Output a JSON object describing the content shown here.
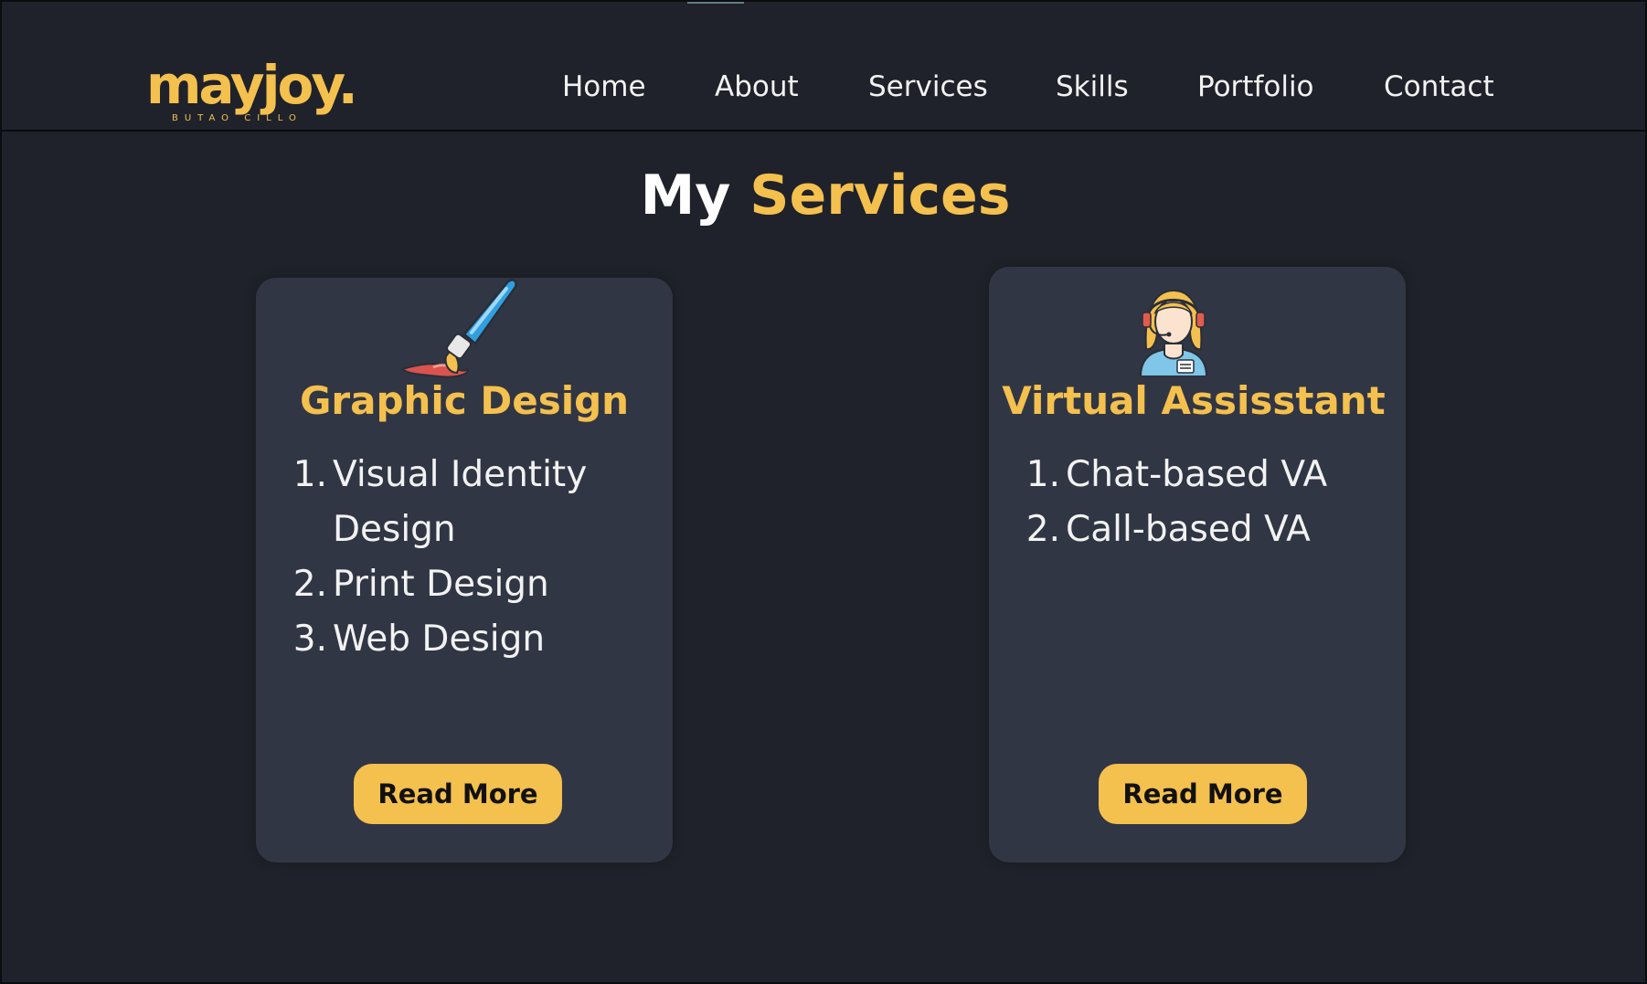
{
  "header": {
    "logo_text": "mayjoy.",
    "logo_subtext": "BUTAO CILLO",
    "nav": [
      {
        "label": "Home"
      },
      {
        "label": "About"
      },
      {
        "label": "Services"
      },
      {
        "label": "Skills"
      },
      {
        "label": "Portfolio"
      },
      {
        "label": "Contact"
      }
    ]
  },
  "section": {
    "title_prefix": "My",
    "title_accent": "Services"
  },
  "cards": [
    {
      "icon": "paintbrush-icon",
      "title": "Graphic Design",
      "items": [
        {
          "num": "1.",
          "text": "Visual Identity Design"
        },
        {
          "num": "2.",
          "text": "Print Design"
        },
        {
          "num": "3.",
          "text": "Web Design"
        }
      ],
      "button_label": "Read More"
    },
    {
      "icon": "virtual-assistant-icon",
      "title": "Virtual Assisstant",
      "items": [
        {
          "num": "1.",
          "text": "Chat-based VA"
        },
        {
          "num": "2.",
          "text": "Call-based VA"
        }
      ],
      "button_label": "Read More"
    }
  ],
  "colors": {
    "background": "#1f222a",
    "card": "#313644",
    "accent": "#f4c04e",
    "text": "#f2f2f2"
  }
}
